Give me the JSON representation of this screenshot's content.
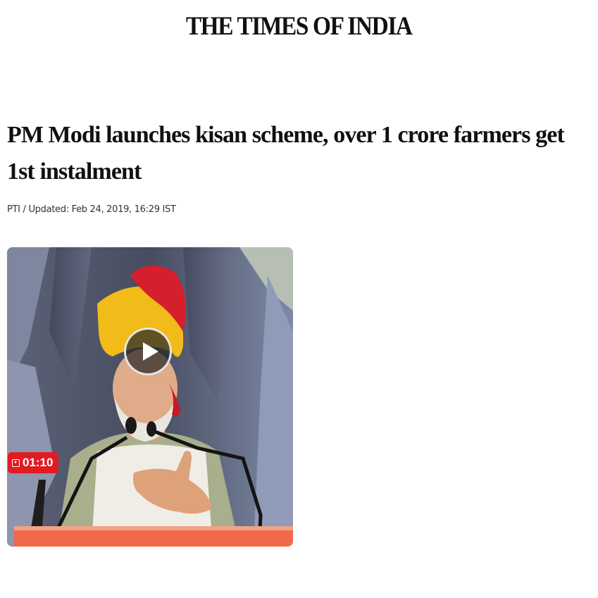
{
  "masthead": {
    "logo_text": "THE TIMES OF INDIA"
  },
  "article": {
    "headline": "PM Modi launches kisan scheme, over 1 crore farmers get 1st instalment",
    "byline": "PTI / Updated: Feb 24, 2019, 16:29 IST"
  },
  "video": {
    "duration": "01:10",
    "play_icon": "play-icon",
    "badge_icon": "video-icon",
    "badge_color": "#e21b22"
  }
}
